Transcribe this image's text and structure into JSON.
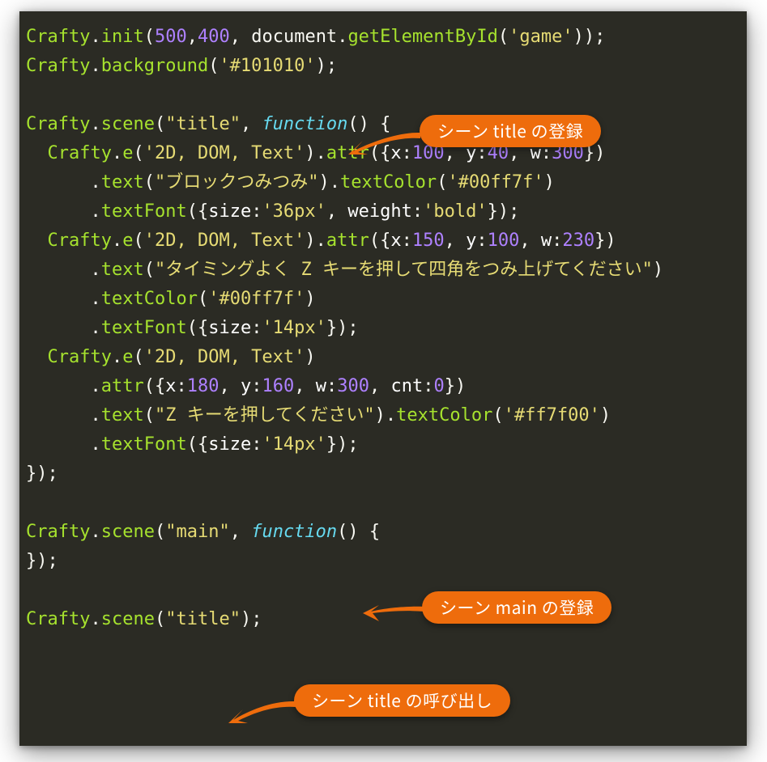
{
  "colors": {
    "background": "#2b2b24",
    "callout_bg": "#ee6c0c",
    "callout_fg": "#ffffff",
    "tok_id": "#a6e22e",
    "tok_num": "#ae81ff",
    "tok_str": "#e6db74",
    "tok_kw": "#66d9ef",
    "tok_punc": "#f8f8f2"
  },
  "callouts": {
    "c1": "シーン title の登録",
    "c2": "シーン main の登録",
    "c3": "シーン title の呼び出し"
  },
  "code": {
    "l1": {
      "crafty": "Crafty",
      "dot1": ".",
      "init": "init",
      "lp": "(",
      "n1": "500",
      "comma1": ",",
      "n2": "400",
      "comma2": ", ",
      "doc": "document",
      "dot2": ".",
      "gebi": "getElementById",
      "lp2": "(",
      "s1": "'game'",
      "rp2": ")",
      "rp": ")",
      "semi": ";"
    },
    "l2": {
      "crafty": "Crafty",
      "dot": ".",
      "bg": "background",
      "lp": "(",
      "s": "'#101010'",
      "rp": ")",
      "semi": ";"
    },
    "l3": {},
    "l4": {
      "crafty": "Crafty",
      "dot": ".",
      "scene": "scene",
      "lp": "(",
      "s": "\"title\"",
      "comma": ", ",
      "kw": "function",
      "lp2": "(",
      "rp2": ")",
      "sp": " ",
      "lb": "{"
    },
    "l5": {
      "indent": "  ",
      "crafty": "Crafty",
      "dot": ".",
      "e": "e",
      "lp": "(",
      "s": "'2D, DOM, Text'",
      "rp": ")",
      "dot2": ".",
      "attr": "attr",
      "lp2": "(",
      "lb": "{",
      "k1": "x",
      "c1": ":",
      "n1": "100",
      "comma1": ", ",
      "k2": "y",
      "c2": ":",
      "n2": "40",
      "comma2": ", ",
      "k3": "w",
      "c3": ":",
      "n3": "300",
      "rb": "}",
      "rp2": ")"
    },
    "l6": {
      "indent": "      ",
      "dot": ".",
      "text": "text",
      "lp": "(",
      "s": "\"ブロックつみつみ\"",
      "rp": ")",
      "dot2": ".",
      "tc": "textColor",
      "lp2": "(",
      "s2": "'#00ff7f'",
      "rp2": ")"
    },
    "l7": {
      "indent": "      ",
      "dot": ".",
      "tf": "textFont",
      "lp": "(",
      "lb": "{",
      "k1": "size",
      "c1": ":",
      "s1": "'36px'",
      "comma": ", ",
      "k2": "weight",
      "c2": ":",
      "s2": "'bold'",
      "rb": "}",
      "rp": ")",
      "semi": ";"
    },
    "l8": {
      "indent": "  ",
      "crafty": "Crafty",
      "dot": ".",
      "e": "e",
      "lp": "(",
      "s": "'2D, DOM, Text'",
      "rp": ")",
      "dot2": ".",
      "attr": "attr",
      "lp2": "(",
      "lb": "{",
      "k1": "x",
      "c1": ":",
      "n1": "150",
      "comma1": ", ",
      "k2": "y",
      "c2": ":",
      "n2": "100",
      "comma2": ", ",
      "k3": "w",
      "c3": ":",
      "n3": "230",
      "rb": "}",
      "rp2": ")"
    },
    "l9": {
      "indent": "      ",
      "dot": ".",
      "text": "text",
      "lp": "(",
      "s": "\"タイミングよく Z キーを押して四角をつみ上げてください\"",
      "rp": ")"
    },
    "l10": {
      "indent": "      ",
      "dot": ".",
      "tc": "textColor",
      "lp": "(",
      "s": "'#00ff7f'",
      "rp": ")"
    },
    "l11": {
      "indent": "      ",
      "dot": ".",
      "tf": "textFont",
      "lp": "(",
      "lb": "{",
      "k1": "size",
      "c1": ":",
      "s1": "'14px'",
      "rb": "}",
      "rp": ")",
      "semi": ";"
    },
    "l12": {
      "indent": "  ",
      "crafty": "Crafty",
      "dot": ".",
      "e": "e",
      "lp": "(",
      "s": "'2D, DOM, Text'",
      "rp": ")"
    },
    "l13": {
      "indent": "      ",
      "dot": ".",
      "attr": "attr",
      "lp": "(",
      "lb": "{",
      "k1": "x",
      "c1": ":",
      "n1": "180",
      "comma1": ", ",
      "k2": "y",
      "c2": ":",
      "n2": "160",
      "comma2": ", ",
      "k3": "w",
      "c3": ":",
      "n3": "300",
      "comma3": ", ",
      "k4": "cnt",
      "c4": ":",
      "n4": "0",
      "rb": "}",
      "rp": ")"
    },
    "l14": {
      "indent": "      ",
      "dot": ".",
      "text": "text",
      "lp": "(",
      "s": "\"Z キーを押してください\"",
      "rp": ")",
      "dot2": ".",
      "tc": "textColor",
      "lp2": "(",
      "s2": "'#ff7f00'",
      "rp2": ")"
    },
    "l15": {
      "indent": "      ",
      "dot": ".",
      "tf": "textFont",
      "lp": "(",
      "lb": "{",
      "k1": "size",
      "c1": ":",
      "s1": "'14px'",
      "rb": "}",
      "rp": ")",
      "semi": ";"
    },
    "l16": {
      "rb": "}",
      "rp": ")",
      "semi": ";"
    },
    "l17": {},
    "l18": {
      "crafty": "Crafty",
      "dot": ".",
      "scene": "scene",
      "lp": "(",
      "s": "\"main\"",
      "comma": ", ",
      "kw": "function",
      "lp2": "(",
      "rp2": ")",
      "sp": " ",
      "lb": "{"
    },
    "l19": {
      "rb": "}",
      "rp": ")",
      "semi": ";"
    },
    "l20": {},
    "l21": {
      "crafty": "Crafty",
      "dot": ".",
      "scene": "scene",
      "lp": "(",
      "s": "\"title\"",
      "rp": ")",
      "semi": ";"
    }
  }
}
